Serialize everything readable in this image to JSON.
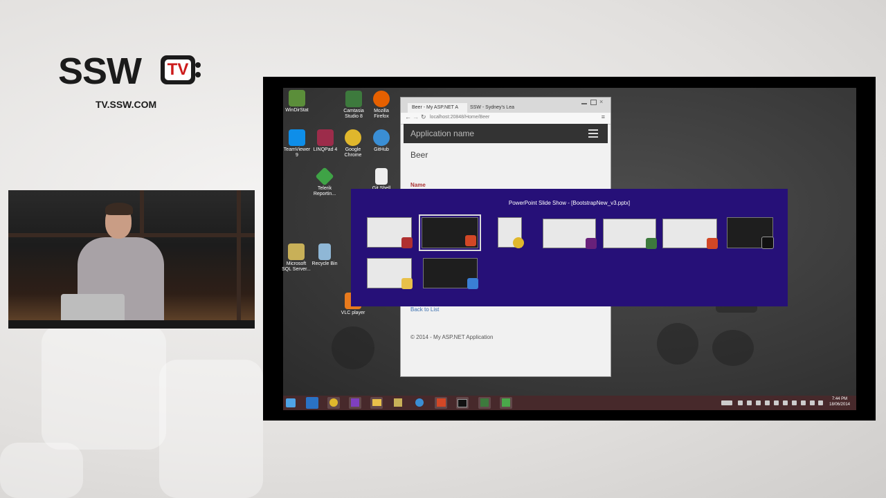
{
  "branding": {
    "logo_text": "SSW",
    "logo_tv": "TV",
    "url": "TV.SSW.COM"
  },
  "colors": {
    "switcher_bg": "#261078",
    "taskbar_bg": "#47292b",
    "logo_red": "#cc1b1b"
  },
  "desktop_icons": [
    {
      "label": "WinDirStat",
      "icon": "tree-icon",
      "color": "#5b8e3a"
    },
    {
      "label": "Camtasia Studio 8",
      "icon": "camtasia-icon",
      "color": "#3d7a3d"
    },
    {
      "label": "Mozilla Firefox",
      "icon": "firefox-icon",
      "color": "#e66000"
    },
    {
      "label": "TeamViewer 9",
      "icon": "teamviewer-icon",
      "color": "#0e8ee9"
    },
    {
      "label": "LINQPad 4",
      "icon": "linqpad-icon",
      "color": "#9c2c4a"
    },
    {
      "label": "Google Chrome",
      "icon": "chrome-icon",
      "color": "#e0b72c"
    },
    {
      "label": "GitHub",
      "icon": "github-icon",
      "color": "#3a8ed4"
    },
    {
      "label": "Telerik Reportin...",
      "icon": "telerik-icon",
      "color": "#3fa346"
    },
    {
      "label": "Git Shell",
      "icon": "file-icon",
      "color": "#eeeeee"
    },
    {
      "label": "Microsoft SQL Server...",
      "icon": "sql-server-icon",
      "color": "#c8b058"
    },
    {
      "label": "Recycle Bin",
      "icon": "recycle-bin-icon",
      "color": "#8fb7d6"
    },
    {
      "label": "VLC player",
      "icon": "vlc-icon",
      "color": "#e87a1d"
    }
  ],
  "browser": {
    "tab1": "Beer - My ASP.NET A",
    "tab2": "SSW - Sydney's Lea",
    "url": "localhost:20848/Home/Beer",
    "app_name": "Application name",
    "page_title": "Beer",
    "field_label": "Name",
    "back_link": "Back to List",
    "footer": "© 2014 - My ASP.NET Application"
  },
  "switcher": {
    "title": "PowerPoint Slide Show - [BootstrapNew_v3.pptx]"
  },
  "taskbar": {
    "time": "7:44 PM",
    "date": "18/06/2014"
  }
}
